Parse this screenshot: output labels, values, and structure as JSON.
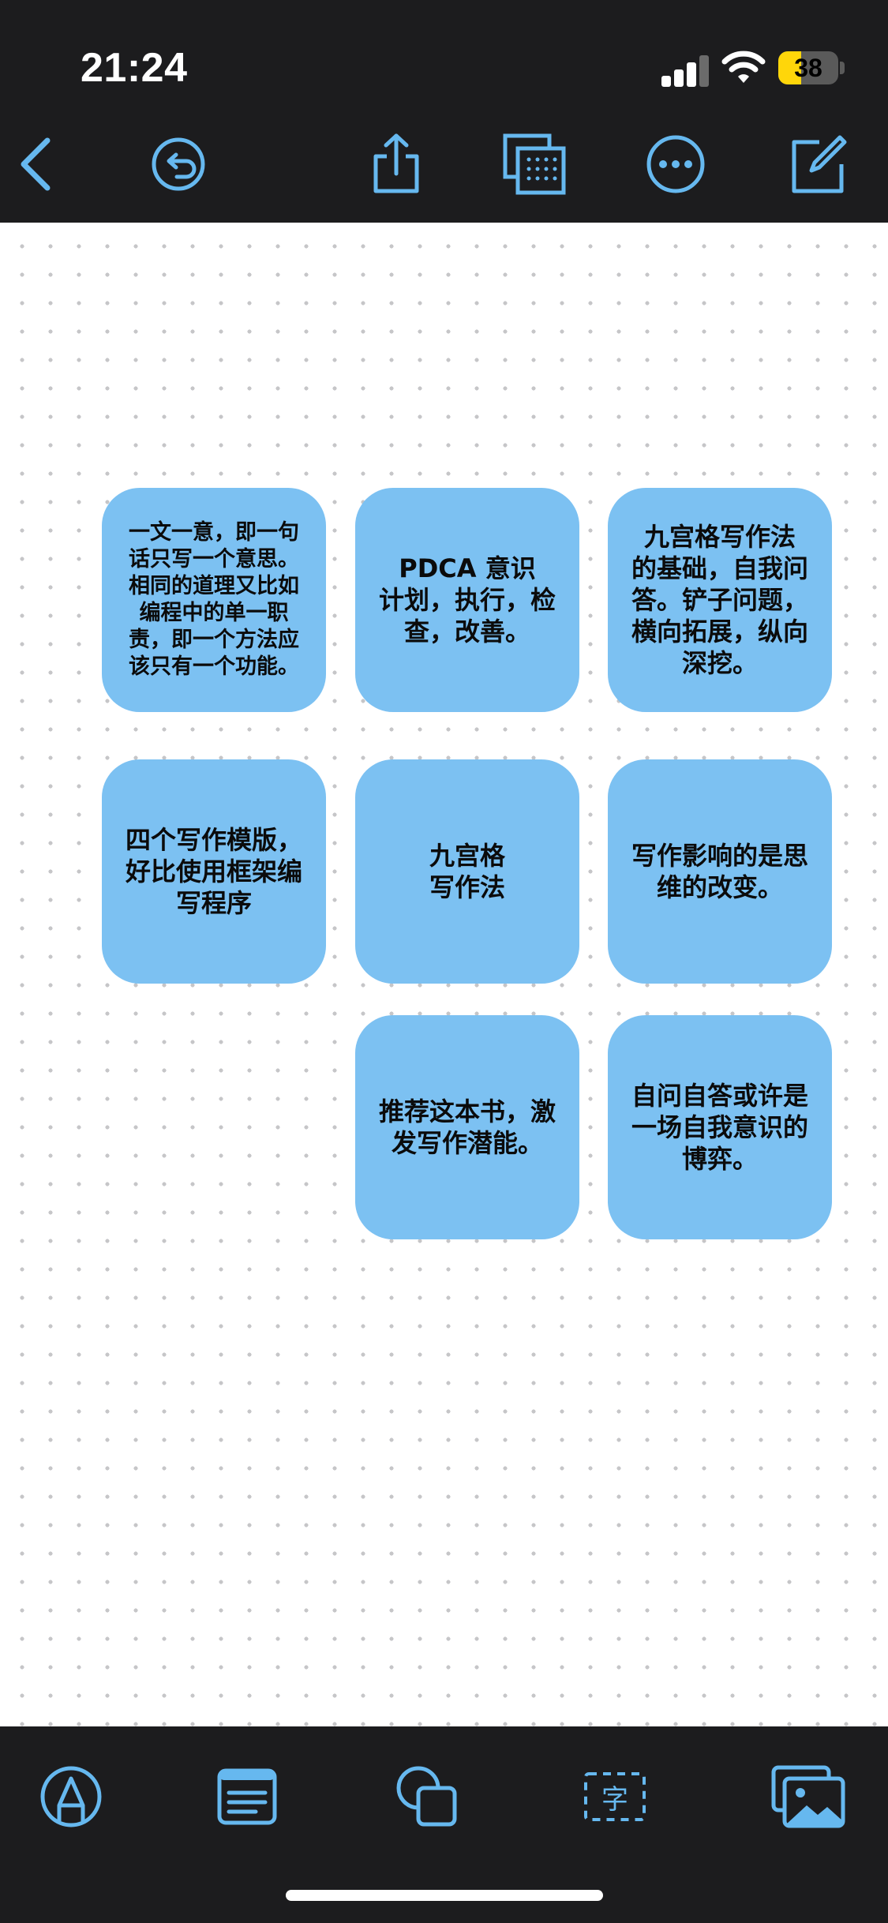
{
  "status_bar": {
    "time": "21:24",
    "battery": "38",
    "battery_level": 0.38
  },
  "accent_color": "#66b8ef",
  "toolbar": {
    "icons": [
      "back-chevron-icon",
      "undo-icon",
      "share-icon",
      "grid-view-icon",
      "more-icon",
      "compose-icon"
    ]
  },
  "notes": [
    {
      "text": "一文一意，即一句\n话只写一个意思。\n相同的道理又比如\n编程中的单一职\n责，即一个方法应\n该只有一个功能。"
    },
    {
      "text": "PDCA 意识\n计划，执行，检\n查，改善。"
    },
    {
      "text": "九宫格写作法\n的基础，自我问\n答。铲子问题，\n横向拓展，纵向\n深挖。"
    },
    {
      "text": "四个写作模版，\n好比使用框架编\n写程序"
    },
    {
      "text": "九宫格\n写作法"
    },
    {
      "text": "写作影响的是思\n维的改变。"
    },
    {
      "text": "推荐这本书，激\n发写作潜能。"
    },
    {
      "text": "自问自答或许是\n一场自我意识的\n博弈。"
    }
  ],
  "note_color": "#7cc1f2",
  "bottom_tools": [
    "pen-icon",
    "note-text-icon",
    "shapes-icon",
    "text-box-icon",
    "photo-icon"
  ]
}
